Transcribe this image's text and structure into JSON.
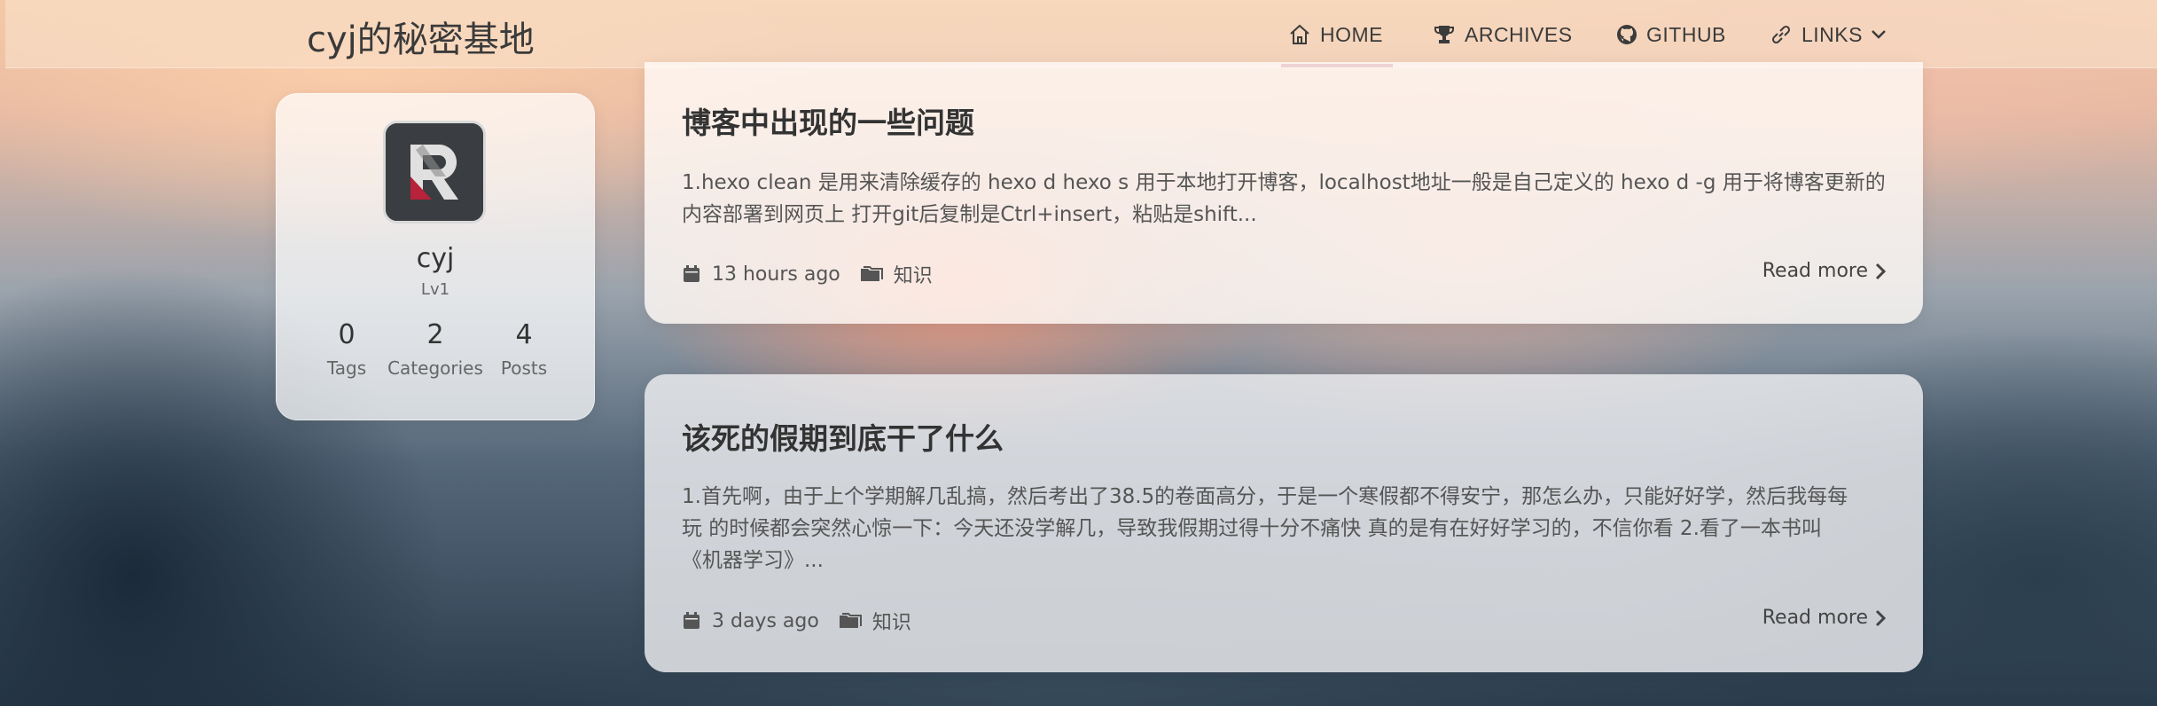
{
  "site": {
    "title": "cyj的秘密基地"
  },
  "nav": {
    "home": "HOME",
    "archives": "ARCHIVES",
    "github": "GITHUB",
    "links": "LINKS",
    "active": "home",
    "accent_color": "#a3203b"
  },
  "profile": {
    "name": "cyj",
    "level": "Lv1",
    "stats": [
      {
        "value": "0",
        "label": "Tags"
      },
      {
        "value": "2",
        "label": "Categories"
      },
      {
        "value": "4",
        "label": "Posts"
      }
    ]
  },
  "posts": [
    {
      "title": "博客中出现的一些问题",
      "excerpt_line1": "1.hexo clean 是用来清除缓存的 hexo d hexo s 用于本地打开博客，localhost地址一般是自己定义的 hexo d -g 用于将博客更新的",
      "excerpt_line2": "内容部署到网页上 打开git后复制是Ctrl+insert，粘贴是shift...",
      "date": "13 hours ago",
      "category": "知识",
      "read_more": "Read more"
    },
    {
      "title": "该死的假期到底干了什么",
      "excerpt_line1": "1.首先啊，由于上个学期解几乱搞，然后考出了38.5的卷面高分，于是一个寒假都不得安宁，那怎么办，只能好好学，然后我每每",
      "excerpt_line2": "玩 的时候都会突然心惊一下：今天还没学解几，导致我假期过得十分不痛快 真的是有在好好学习的，不信你看 2.看了一本书叫",
      "excerpt_line3": "《机器学习》...",
      "date": "3 days ago",
      "category": "知识",
      "read_more": "Read more"
    }
  ]
}
